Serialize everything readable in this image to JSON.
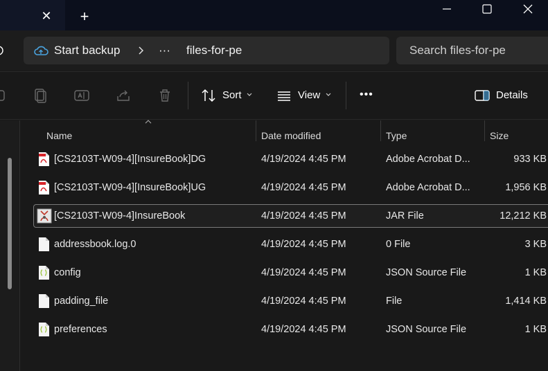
{
  "window": {
    "tab_close_glyph": "✕",
    "new_tab_glyph": "+"
  },
  "address": {
    "crumb_root": "Start backup",
    "crumb_more": "···",
    "crumb_current": "files-for-pe",
    "search_placeholder": "Search files-for-pe"
  },
  "toolbar": {
    "sort_label": "Sort",
    "view_label": "View",
    "more_label": "•••",
    "details_label": "Details"
  },
  "columns": {
    "name": "Name",
    "date": "Date modified",
    "type": "Type",
    "size": "Size"
  },
  "files": [
    {
      "name": "[CS2103T-W09-4][InsureBook]DG",
      "date": "4/19/2024 4:45 PM",
      "type": "Adobe Acrobat D...",
      "size": "933 KB",
      "icon": "pdf-icon"
    },
    {
      "name": "[CS2103T-W09-4][InsureBook]UG",
      "date": "4/19/2024 4:45 PM",
      "type": "Adobe Acrobat D...",
      "size": "1,956 KB",
      "icon": "pdf-icon"
    },
    {
      "name": "[CS2103T-W09-4]InsureBook",
      "date": "4/19/2024 4:45 PM",
      "type": "JAR File",
      "size": "12,212 KB",
      "icon": "jar-icon"
    },
    {
      "name": "addressbook.log.0",
      "date": "4/19/2024 4:45 PM",
      "type": "0 File",
      "size": "3 KB",
      "icon": "file-icon"
    },
    {
      "name": "config",
      "date": "4/19/2024 4:45 PM",
      "type": "JSON Source File",
      "size": "1 KB",
      "icon": "json-icon"
    },
    {
      "name": "padding_file",
      "date": "4/19/2024 4:45 PM",
      "type": "File",
      "size": "1,414 KB",
      "icon": "file-icon"
    },
    {
      "name": "preferences",
      "date": "4/19/2024 4:45 PM",
      "type": "JSON Source File",
      "size": "1 KB",
      "icon": "json-icon"
    }
  ],
  "colors": {
    "background": "#191919",
    "titlebar": "#0b0f1c",
    "pdf_red": "#d9252b",
    "json_green": "#9bc53d",
    "cloud_blue": "#4aa3df"
  }
}
